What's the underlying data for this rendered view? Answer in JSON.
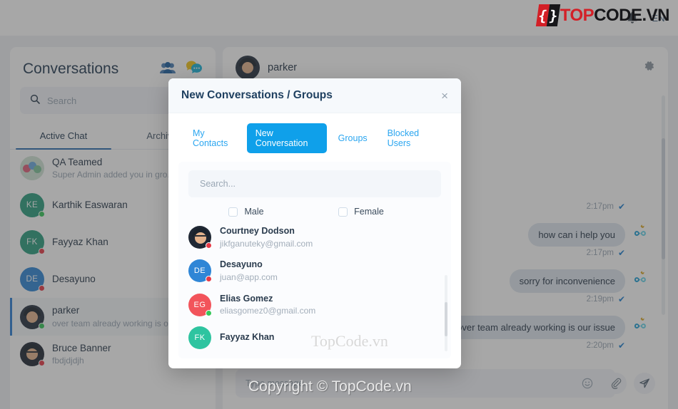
{
  "topbar": {
    "bell_icon": "bell-icon",
    "language": "EN"
  },
  "watermarks": {
    "logo_brace_left": "{",
    "logo_brace_right": "}",
    "logo_top": "TOP",
    "logo_code": "CODE",
    "logo_tld": ".VN",
    "middle": "TopCode.vn",
    "bottom": "Copyright © TopCode.vn"
  },
  "sidebar": {
    "title": "Conversations",
    "group_icon": "group-people-icon",
    "new_chat_icon": "new-chat-bubble-icon",
    "search": {
      "placeholder": "Search",
      "icon": "search-icon"
    },
    "tabs": [
      {
        "label": "Active Chat",
        "active": true
      },
      {
        "label": "Archive",
        "active": false
      }
    ],
    "conversations": [
      {
        "name": "QA Teamed",
        "preview": "Super Admin added you in gro..",
        "avatar_type": "group",
        "initials": "",
        "color": "#cfe3d6",
        "status": "",
        "selected": false
      },
      {
        "name": "Karthik Easwaran",
        "preview": "",
        "avatar_type": "initials",
        "initials": "KE",
        "color": "#2a9d7f",
        "status": "#35c75a",
        "selected": false
      },
      {
        "name": "Fayyaz Khan",
        "preview": "",
        "avatar_type": "initials",
        "initials": "FK",
        "color": "#2a9d7f",
        "status": "#e63946",
        "selected": false
      },
      {
        "name": "Desayuno",
        "preview": "",
        "avatar_type": "initials",
        "initials": "DE",
        "color": "#2f86d6",
        "status": "#e63946",
        "selected": false
      },
      {
        "name": "parker",
        "preview": "over team already working is ou..",
        "avatar_type": "photo",
        "initials": "",
        "color": "#26313f",
        "status": "#35c75a",
        "selected": true
      },
      {
        "name": "Bruce Banner",
        "preview": "fbdjdjdjh",
        "avatar_type": "photo",
        "initials": "",
        "color": "#1f2733",
        "status": "#e63946",
        "selected": false
      }
    ]
  },
  "chat": {
    "header": {
      "name": "parker",
      "gear_icon": "gear-settings-icon",
      "avatar": "photo-avatar"
    },
    "messages": [
      {
        "text": "",
        "time": "2:17pm",
        "tick": "✔",
        "has_bubble": false,
        "avatar_icon": "infinity-crown-icon"
      },
      {
        "text": "how can i help you",
        "time": "2:17pm",
        "tick": "✔",
        "has_bubble": true,
        "avatar_icon": "infinity-crown-icon"
      },
      {
        "text": "sorry for inconvenience",
        "time": "2:19pm",
        "tick": "✔",
        "has_bubble": true,
        "avatar_icon": "infinity-crown-icon"
      },
      {
        "text": "over team already working is our issue",
        "time": "2:20pm",
        "tick": "✔",
        "has_bubble": true,
        "avatar_icon": "infinity-crown-icon"
      }
    ],
    "input": {
      "placeholder": "Type message...",
      "emoji_icon": "emoji-smiley-icon",
      "attach_icon": "paperclip-attach-icon",
      "send_icon": "send-paper-plane-icon"
    }
  },
  "modal": {
    "title": "New Conversations / Groups",
    "close_icon": "close-x-icon",
    "tabs": [
      {
        "label": "My Contacts",
        "active": false
      },
      {
        "label": "New Conversation",
        "active": true
      },
      {
        "label": "Groups",
        "active": false
      },
      {
        "label": "Blocked Users",
        "active": false
      }
    ],
    "search": {
      "placeholder": "Search..."
    },
    "filters": [
      {
        "label": "Male",
        "checked": false
      },
      {
        "label": "Female",
        "checked": false
      }
    ],
    "contacts": [
      {
        "name": "Courtney Dodson",
        "email": "jikfganuteky@gmail.com",
        "avatar_type": "photo",
        "initials": "",
        "color": "#1f2733",
        "status": "#e63946"
      },
      {
        "name": "Desayuno",
        "email": "juan@app.com",
        "avatar_type": "initials",
        "initials": "DE",
        "color": "#2f86d6",
        "status": "#e63946"
      },
      {
        "name": "Elias Gomez",
        "email": "eliasgomez0@gmail.com",
        "avatar_type": "initials",
        "initials": "EG",
        "color": "#f2545b",
        "status": "#35c75a"
      },
      {
        "name": "Fayyaz Khan",
        "email": "",
        "avatar_type": "initials",
        "initials": "FK",
        "color": "#2ec4a0",
        "status": ""
      }
    ]
  },
  "colors": {
    "accent_blue": "#0fa0ea",
    "link_blue": "#2ba6f0",
    "selected_border": "#2b7fd4",
    "tick_blue": "#1e7fd0",
    "online_green": "#35c75a",
    "offline_red": "#e63946"
  }
}
